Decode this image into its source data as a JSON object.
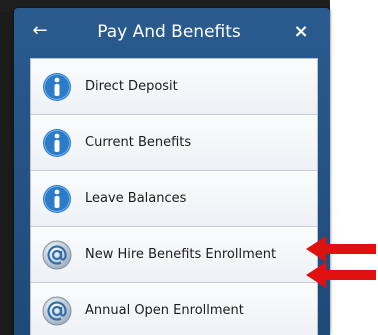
{
  "header": {
    "title": "Pay And Benefits",
    "back_glyph": "←",
    "close_glyph": "×"
  },
  "menu": {
    "items": [
      {
        "label": "Direct Deposit",
        "icon": "info-icon"
      },
      {
        "label": "Current Benefits",
        "icon": "info-icon"
      },
      {
        "label": "Leave Balances",
        "icon": "info-icon"
      },
      {
        "label": "New Hire Benefits Enrollment",
        "icon": "at-sign-icon"
      },
      {
        "label": "Annual Open Enrollment",
        "icon": "at-sign-icon"
      }
    ]
  },
  "colors": {
    "header_blue": "#2a5b8f",
    "info_blue": "#2b7bc7",
    "annotation_red": "#e01010"
  }
}
